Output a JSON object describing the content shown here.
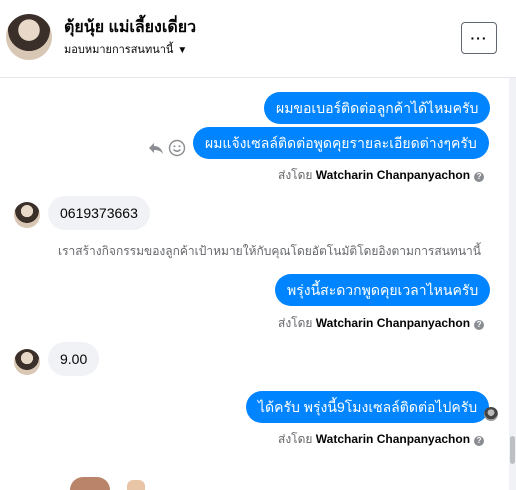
{
  "header": {
    "title": "ตุ้ยนุ้ย แม่เลี้ยงเดี่ยว",
    "subtitle": "มอบหมายการสนทนานี้",
    "more_label": "···"
  },
  "messages": {
    "out1": "ผมขอเบอร์ติดต่อลูกค้าได้ไหมครับ",
    "out2": "ผมแจ้งเซลล์ติดต่อพูดคุยรายละเอียดต่างๆครับ",
    "sent_by_prefix": "ส่งโดย",
    "sent_by_name": "Watcharin Chanpanyachon",
    "in1": "0619373663",
    "system": "เราสร้างกิจกรรมของลูกค้าเป้าหมายให้กับคุณโดยอัตโนมัติโดยอิงตามการสนทนานี้",
    "out3": "พรุ่งนี้สะดวกพูดคุยเวลาไหนครับ",
    "in2": "9.00",
    "out4": "ได้ครับ พรุ่งนี้9โมงเซลล์ติดต่อไปครับ"
  },
  "icons": {
    "reply": "reply-icon",
    "react": "smile-icon",
    "info": "info-icon",
    "caret": "caret-down-icon"
  },
  "colors": {
    "outgoing_bubble": "#0084ff",
    "incoming_bubble": "#f0f2f5",
    "muted_text": "#65676b"
  }
}
